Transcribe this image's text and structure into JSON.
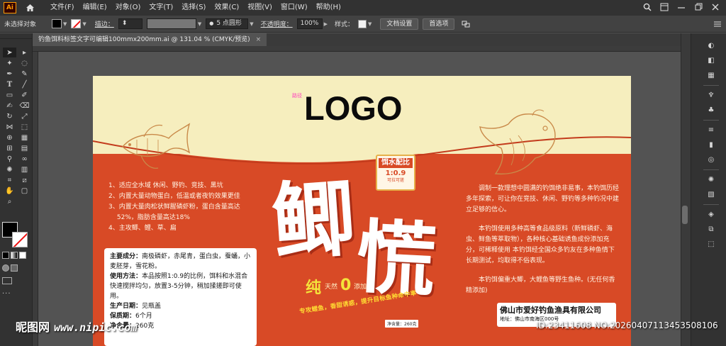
{
  "app": {
    "logo_text": "Ai",
    "menus": [
      "文件(F)",
      "编辑(E)",
      "对象(O)",
      "文字(T)",
      "选择(S)",
      "效果(C)",
      "视图(V)",
      "窗口(W)",
      "帮助(H)"
    ]
  },
  "control_bar": {
    "selection_status": "未选择对象",
    "stroke_label": "描边：",
    "brush_size": "5 点圆形",
    "opacity_label": "不透明度：",
    "opacity_value": "100%",
    "style_label": "样式：",
    "doc_setup_button": "文档设置",
    "preferences_button": "首选项"
  },
  "document": {
    "tab_title": "钓鱼饵料标签文字可编辑100mmx200mm.ai @ 131.04 % (CMYK/预览)",
    "tab_close": "×"
  },
  "artwork": {
    "logo": "LOGO",
    "tiny_tag": "路径",
    "bait_box": {
      "title": "饵水配比",
      "ratio": "1:0.9",
      "sub": "可拉可搓"
    },
    "title_chars": [
      "鲫",
      "慌"
    ],
    "pure_main": "纯",
    "pure_mid": "天然",
    "pure_c": "0",
    "pure_end": "添加",
    "ribbon": "专攻鲤鱼，香甜诱惑，提升目标鱼种命中率",
    "net_tag": "净含量：260克",
    "features": [
      "1、适应全水域 休闲、野钓、竞技、黑坑",
      "2、内置大量动物蛋白，低温或者夜钓效果更佳",
      "3、内置大量肉松状鲜腥磷虾粉，蛋白含量高达",
      "　 52%，脂肪含量高达18%",
      "4、主攻鲫、鲤、草、扁"
    ],
    "right_paragraphs": [
      "调制一款理想中圆满的钓饵绝非易事，本钓饵历经多年探索，可让你在竞技、休闲、野钓等多种钓况中建立足够的信心。",
      "本钓饵使用多种高等食品级原料（新鲜磷虾、海虫、鲜鱼等萃取物），各种核心基础诱鱼成份添加充分，可稀释使用 本钓饵经全国众多钓友在多种鱼情下长期测试，均取得不俗表现。",
      "本钓饵偏重大鲫，大鲤鱼等野生鱼种。(无任何香精添加)"
    ],
    "info": {
      "ingredients_label": "主要成分：",
      "ingredients": "南极磷虾，赤尾青，蛋白虫，蚕蛹，小麦胚芽，雪花粉。",
      "usage_label": "使用方法：",
      "usage": "本品按照1:0.9的比例，饵料和水混合快速搅拌均匀，放置3-5分钟，稍加揉搓即可使用。",
      "date_label": "生产日期：",
      "date": "见瓶盖",
      "shelf_label": "保质期：",
      "shelf": "6个月",
      "net_label": "净含量：",
      "net": "260克"
    },
    "company": {
      "name": "佛山市爱好钓鱼渔具有限公司",
      "address": "地址：佛山市南海区000号"
    }
  },
  "watermark": {
    "site": "昵图网",
    "url": "www.nipic.com",
    "id_text": "ID:23411608 NO:20260407113453508106"
  },
  "colors": {
    "artboard_red": "#d84a26",
    "cream": "#f6eebe",
    "accent_orange": "#ff9a00"
  }
}
